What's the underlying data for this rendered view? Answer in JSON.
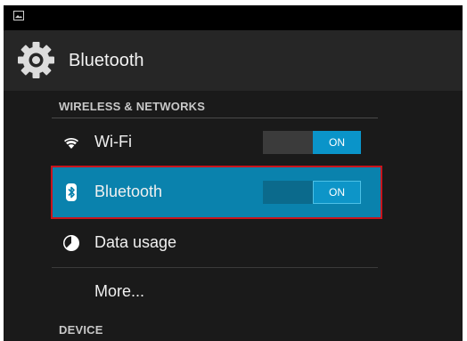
{
  "status_bar": {
    "icon": "picture-icon"
  },
  "action_bar": {
    "icon": "gear-icon",
    "title": "Bluetooth"
  },
  "sections": {
    "wireless": "WIRELESS & NETWORKS",
    "device": "DEVICE"
  },
  "items": {
    "wifi": {
      "icon": "wifi-icon",
      "label": "Wi-Fi",
      "toggle": "ON"
    },
    "bluetooth": {
      "icon": "bluetooth-icon",
      "label": "Bluetooth",
      "toggle": "ON"
    },
    "data_usage": {
      "icon": "pie-chart-icon",
      "label": "Data usage"
    },
    "more": {
      "label": "More..."
    }
  },
  "colors": {
    "accent": "#0a82ad",
    "toggle_on": "#0a94c9",
    "highlight_outline": "#c9141c",
    "background": "#1a1a1a"
  }
}
